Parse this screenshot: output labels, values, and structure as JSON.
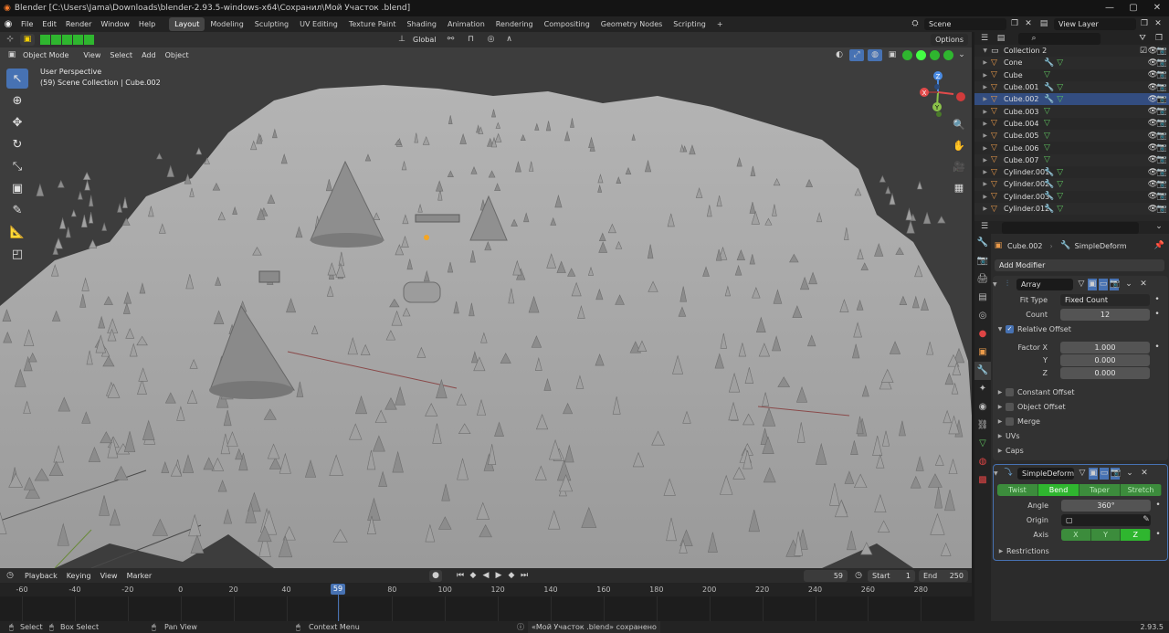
{
  "window": {
    "title": "Blender [C:\\Users\\Jama\\Downloads\\blender-2.93.5-windows-x64\\Сохранил\\Мой Участок .blend]",
    "min": "—",
    "max": "▢",
    "close": "✕"
  },
  "menubar": {
    "menus": [
      "File",
      "Edit",
      "Render",
      "Window",
      "Help"
    ],
    "workspaces": [
      "Layout",
      "Modeling",
      "Sculpting",
      "UV Editing",
      "Texture Paint",
      "Shading",
      "Animation",
      "Rendering",
      "Compositing",
      "Geometry Nodes",
      "Scripting"
    ],
    "active_workspace": "Layout",
    "add_tab": "+",
    "scene": "Scene",
    "view_layer": "View Layer"
  },
  "viewport": {
    "orientation": "Global",
    "options": "Options",
    "mode": "Object Mode",
    "menus": [
      "View",
      "Select",
      "Add",
      "Object"
    ],
    "perspective": "User Perspective",
    "collection_info": "(59) Scene Collection | Cube.002",
    "gizmo": {
      "x": "X",
      "y": "Y",
      "z": "Z"
    },
    "colors": {
      "background": "#3d3d3d",
      "terrain": "#a8a8a8",
      "x_axis": "#e34b4b",
      "y_axis": "#8bc34a",
      "z_axis": "#4a8be3"
    }
  },
  "outliner": {
    "search_placeholder": "",
    "collection": "Collection 2",
    "items": [
      {
        "name": "Cone",
        "mods": true,
        "selected": false
      },
      {
        "name": "Cube",
        "mods": false,
        "selected": false
      },
      {
        "name": "Cube.001",
        "mods": true,
        "selected": false
      },
      {
        "name": "Cube.002",
        "mods": true,
        "selected": true
      },
      {
        "name": "Cube.003",
        "mods": false,
        "selected": false
      },
      {
        "name": "Cube.004",
        "mods": false,
        "selected": false
      },
      {
        "name": "Cube.005",
        "mods": false,
        "selected": false
      },
      {
        "name": "Cube.006",
        "mods": false,
        "selected": false
      },
      {
        "name": "Cube.007",
        "mods": false,
        "selected": false
      },
      {
        "name": "Cylinder.001",
        "mods": true,
        "selected": false
      },
      {
        "name": "Cylinder.002",
        "mods": true,
        "selected": false
      },
      {
        "name": "Cylinder.003",
        "mods": true,
        "selected": false
      },
      {
        "name": "Cylinder.012",
        "mods": true,
        "selected": false
      }
    ]
  },
  "properties": {
    "object_name": "Cube.002",
    "modifier_name_header": "SimpleDeform",
    "add_modifier": "Add Modifier",
    "array": {
      "name": "Array",
      "fit_type_label": "Fit Type",
      "fit_type": "Fixed Count",
      "count_label": "Count",
      "count": "12",
      "relative_offset": "Relative Offset",
      "factor_x_label": "Factor X",
      "factor_x": "1.000",
      "y_label": "Y",
      "y": "0.000",
      "z_label": "Z",
      "z": "0.000",
      "constant_offset": "Constant Offset",
      "object_offset": "Object Offset",
      "merge": "Merge",
      "uvs": "UVs",
      "caps": "Caps"
    },
    "simple_deform": {
      "name": "SimpleDeform",
      "modes": [
        "Twist",
        "Bend",
        "Taper",
        "Stretch"
      ],
      "active_mode": "Bend",
      "angle_label": "Angle",
      "angle": "360°",
      "origin_label": "Origin",
      "axis_label": "Axis",
      "axes": [
        "X",
        "Y",
        "Z"
      ],
      "active_axis": "Z",
      "restrictions": "Restrictions"
    }
  },
  "timeline": {
    "menus": [
      "Playback",
      "Keying",
      "View",
      "Marker"
    ],
    "current_frame": "59",
    "start_label": "Start",
    "start": "1",
    "end_label": "End",
    "end": "250",
    "ruler": [
      "-60",
      "-40",
      "-20",
      "0",
      "20",
      "40",
      "60",
      "80",
      "100",
      "120",
      "140",
      "160",
      "180",
      "200",
      "220",
      "240",
      "260",
      "280"
    ]
  },
  "statusbar": {
    "select": "Select",
    "box_select": "Box Select",
    "pan_view": "Pan View",
    "context_menu": "Context Menu",
    "notice": "«Мой Участок .blend» сохранено",
    "version": "2.93.5"
  }
}
